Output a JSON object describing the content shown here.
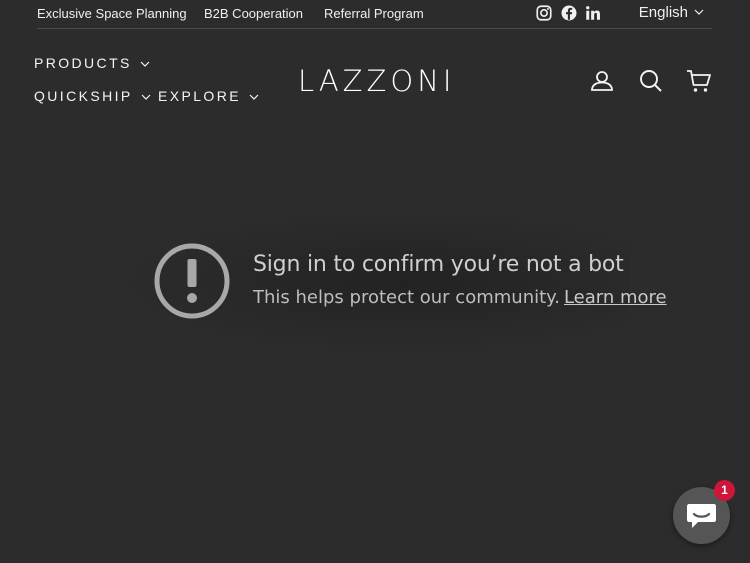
{
  "topbar": {
    "links": [
      "Exclusive Space Planning",
      "B2B Cooperation",
      "Referral Program"
    ],
    "social": [
      "instagram-icon",
      "facebook-icon",
      "linkedin-icon"
    ],
    "language": "English"
  },
  "header": {
    "logo": "LAZZONI",
    "nav": [
      "PRODUCTS",
      "QUICKSHIP",
      "EXPLORE"
    ],
    "icons": [
      "account-icon",
      "search-icon",
      "cart-icon"
    ]
  },
  "overlay": {
    "title": "Sign in to confirm you’re not a bot",
    "description": "This helps protect our community.",
    "link": "Learn more"
  },
  "chat": {
    "badge": "1"
  }
}
